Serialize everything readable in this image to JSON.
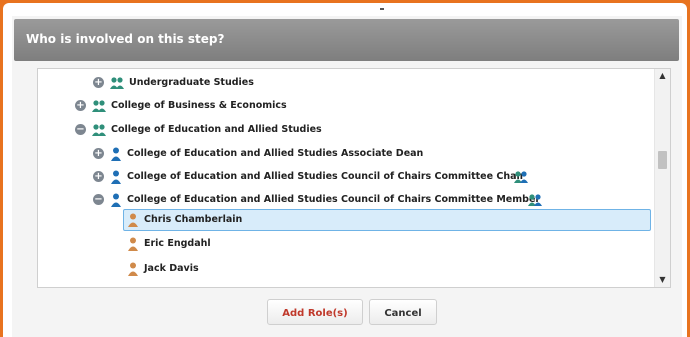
{
  "dialog": {
    "title": "Who is involved on this step?",
    "tree": [
      {
        "label": "Undergraduate Studies",
        "icon": "group-icon",
        "toggle": "plus"
      },
      {
        "label": "College of Business & Economics",
        "icon": "group-icon",
        "toggle": "plus"
      },
      {
        "label": "College of Education and Allied Studies",
        "icon": "group-icon",
        "toggle": "minus"
      },
      {
        "label": "College of Education and Allied Studies Associate Dean",
        "icon": "role-person-icon",
        "toggle": "plus"
      },
      {
        "label": "College of Education and Allied Studies Council of Chairs Committee Chair",
        "icon": "role-person-icon",
        "toggle": "plus",
        "trailing_icon": "group-icon"
      },
      {
        "label": "College of Education and Allied Studies Council of Chairs Committee Member",
        "icon": "role-person-icon",
        "toggle": "minus",
        "trailing_icon": "group-icon"
      },
      {
        "label": "Chris Chamberlain",
        "icon": "user-icon",
        "selected": true
      },
      {
        "label": "Eric Engdahl",
        "icon": "user-icon"
      },
      {
        "label": "Jack Davis",
        "icon": "user-icon"
      }
    ],
    "buttons": {
      "add_roles": "Add Role(s)",
      "cancel": "Cancel"
    },
    "colors": {
      "frame": "#e8731f",
      "titlebar": "#8a8a8a",
      "group_icon": "#2f8f7a",
      "role_icon": "#1f6fb5",
      "user_icon": "#d08a4a",
      "add_roles_text": "#c0392b",
      "selection": "#d8ecfa"
    }
  }
}
